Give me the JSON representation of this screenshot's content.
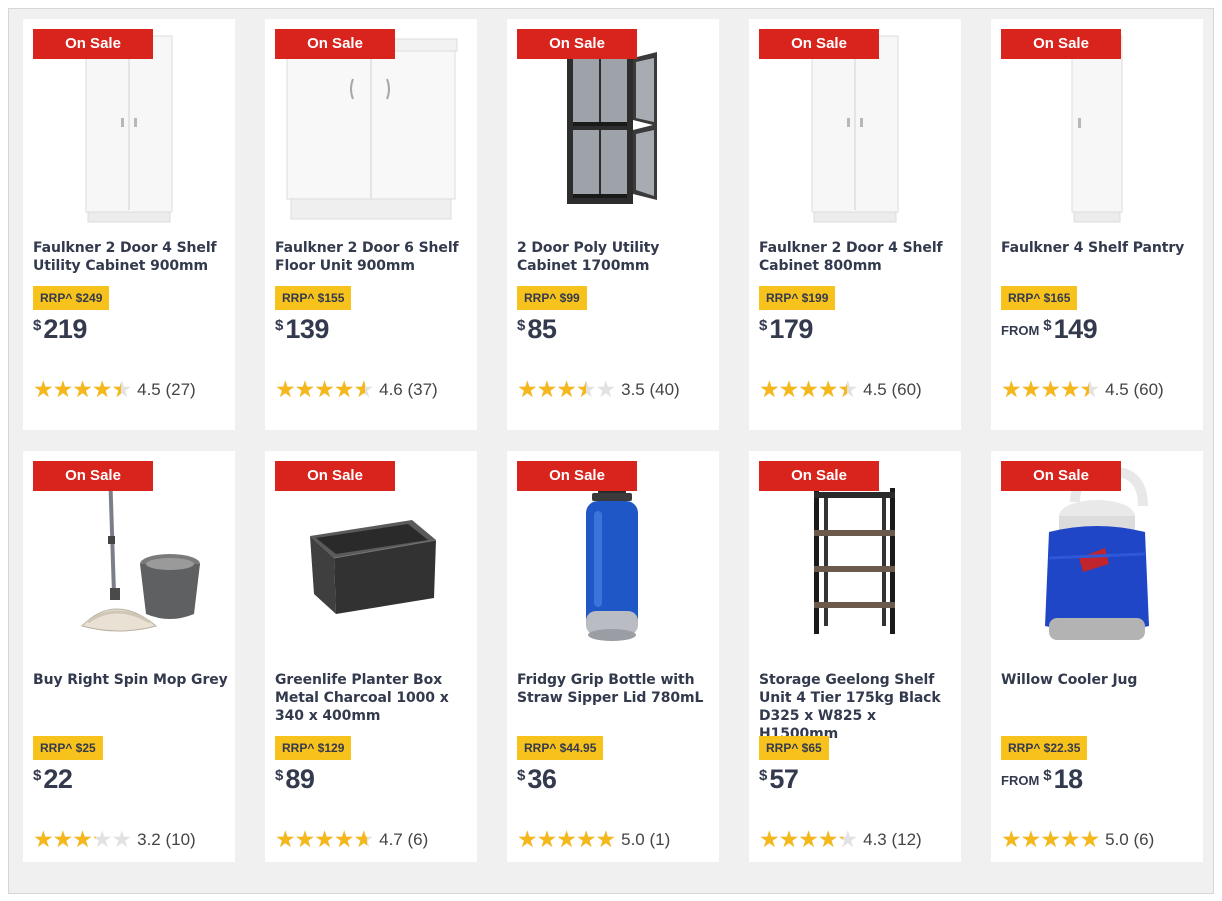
{
  "products": [
    {
      "badge": "On Sale",
      "title": "Faulkner 2 Door 4 Shelf Utility Cabinet 900mm",
      "rrp": "RRP^ $249",
      "from": "",
      "currency": "$",
      "price": "219",
      "rating": 4.5,
      "rating_text": "4.5 (27)",
      "image": "white-tall-cabinet-icon"
    },
    {
      "badge": "On Sale",
      "title": "Faulkner 2 Door 6 Shelf Floor Unit 900mm",
      "rrp": "RRP^ $155",
      "from": "",
      "currency": "$",
      "price": "139",
      "rating": 4.6,
      "rating_text": "4.6 (37)",
      "image": "white-floor-unit-icon"
    },
    {
      "badge": "On Sale",
      "title": "2 Door Poly Utility Cabinet 1700mm",
      "rrp": "RRP^ $99",
      "from": "",
      "currency": "$",
      "price": "85",
      "rating": 3.5,
      "rating_text": "3.5 (40)",
      "image": "poly-cabinet-icon"
    },
    {
      "badge": "On Sale",
      "title": "Faulkner 2 Door 4 Shelf Cabinet 800mm",
      "rrp": "RRP^ $199",
      "from": "",
      "currency": "$",
      "price": "179",
      "rating": 4.5,
      "rating_text": "4.5 (60)",
      "image": "white-tall-cabinet-icon"
    },
    {
      "badge": "On Sale",
      "title": "Faulkner 4 Shelf Pantry",
      "rrp": "RRP^ $165",
      "from": "FROM",
      "currency": "$",
      "price": "149",
      "rating": 4.5,
      "rating_text": "4.5 (60)",
      "image": "white-pantry-icon"
    },
    {
      "badge": "On Sale",
      "title": "Buy Right Spin Mop Grey",
      "rrp": "RRP^ $25",
      "from": "",
      "currency": "$",
      "price": "22",
      "rating": 3.2,
      "rating_text": "3.2 (10)",
      "image": "spin-mop-icon"
    },
    {
      "badge": "On Sale",
      "title": "Greenlife Planter Box Metal Charcoal 1000 x 340 x 400mm",
      "rrp": "RRP^ $129",
      "from": "",
      "currency": "$",
      "price": "89",
      "rating": 4.7,
      "rating_text": "4.7 (6)",
      "image": "planter-box-icon"
    },
    {
      "badge": "On Sale",
      "title": "Fridgy Grip Bottle with Straw Sipper Lid 780mL",
      "rrp": "RRP^ $44.95",
      "from": "",
      "currency": "$",
      "price": "36",
      "rating": 5.0,
      "rating_text": "5.0 (1)",
      "image": "water-bottle-icon"
    },
    {
      "badge": "On Sale",
      "title": "Storage Geelong Shelf Unit 4 Tier 175kg Black D325 x W825 x H1500mm",
      "rrp": "RRP^ $65",
      "from": "",
      "currency": "$",
      "price": "57",
      "rating": 4.3,
      "rating_text": "4.3 (12)",
      "image": "shelf-unit-icon"
    },
    {
      "badge": "On Sale",
      "title": "Willow Cooler Jug",
      "rrp": "RRP^ $22.35",
      "from": "FROM",
      "currency": "$",
      "price": "18",
      "rating": 5.0,
      "rating_text": "5.0 (6)",
      "image": "cooler-jug-icon"
    }
  ]
}
